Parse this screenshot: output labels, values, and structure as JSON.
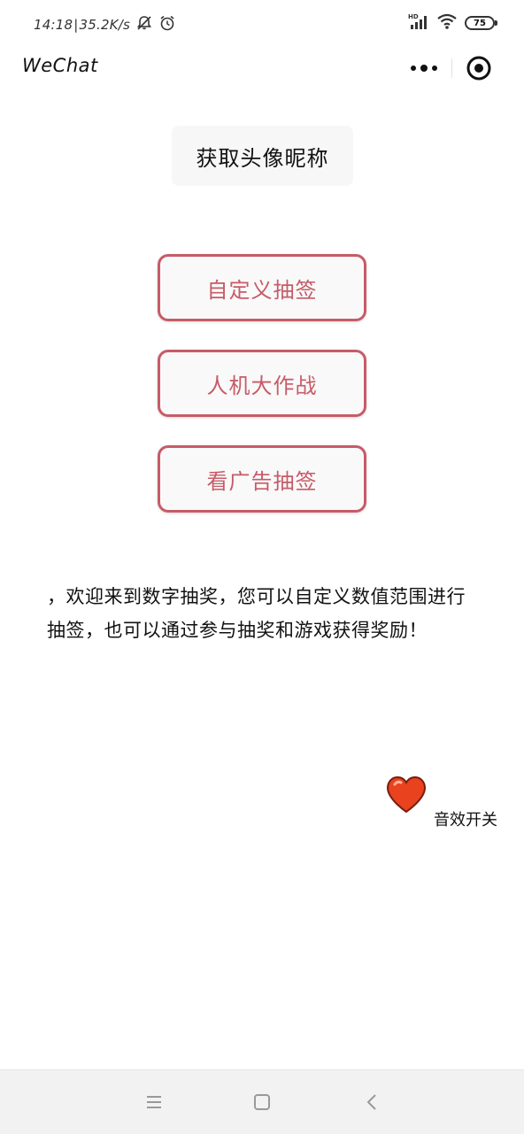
{
  "status_bar": {
    "time": "14:18",
    "network_speed": "35.2K/s",
    "network_type": "HD",
    "battery_level": "75",
    "icons": [
      "mute-icon",
      "alarm-icon",
      "signal-icon",
      "wifi-icon",
      "battery-icon"
    ]
  },
  "title_bar": {
    "app_title": "WeChat",
    "menu_icon": "more-dots-icon",
    "close_icon": "target-close-icon"
  },
  "main": {
    "avatar_button_label": "获取头像昵称",
    "buttons": [
      {
        "label": "自定义抽签"
      },
      {
        "label": "人机大作战"
      },
      {
        "label": "看广告抽签"
      }
    ],
    "welcome_text": "，欢迎来到数字抽奖，您可以自定义数值范围进行抽签，也可以通过参与抽奖和游戏获得奖励！",
    "sound_toggle": {
      "label": "音效开关",
      "icon": "heart-icon"
    }
  },
  "nav_bar": {
    "icons": [
      "menu-icon",
      "home-square-icon",
      "back-chevron-icon"
    ]
  },
  "colors": {
    "accent": "#c75b68",
    "heart": "#e8421e",
    "button_bg": "#f9f9f9",
    "avatar_btn_bg": "#f7f7f7",
    "nav_bg": "#f2f2f2"
  }
}
